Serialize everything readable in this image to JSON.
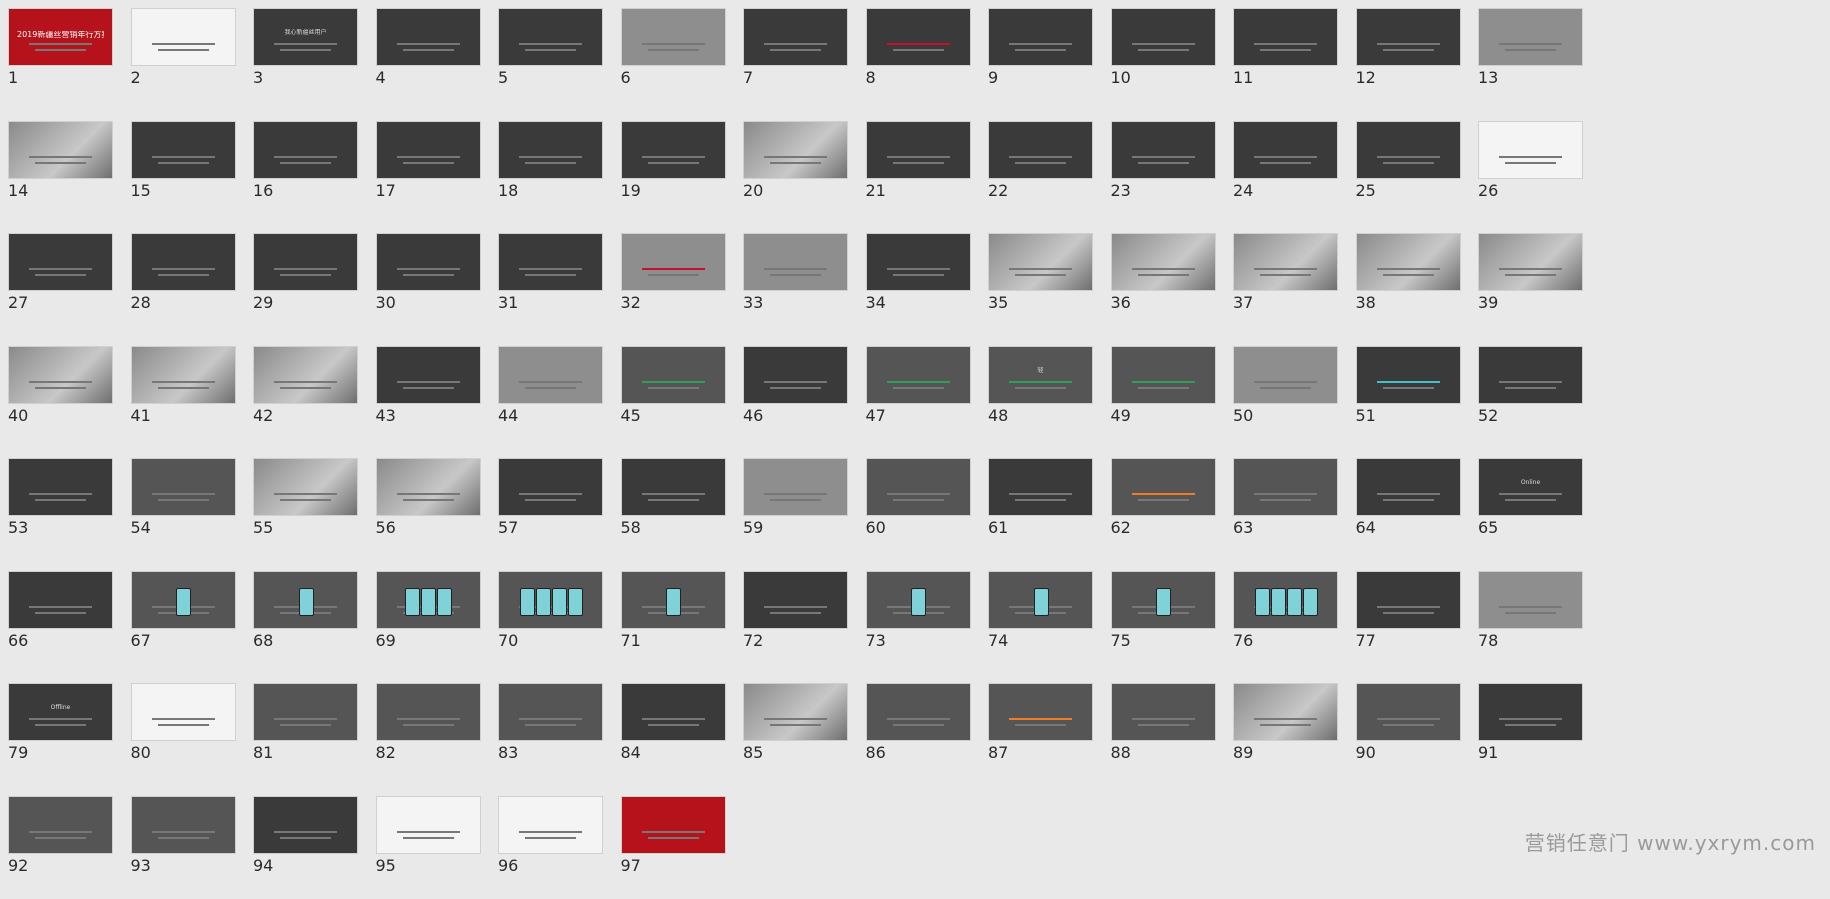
{
  "watermark": "营销任意门 www.yxrym.com",
  "slides": [
    {
      "n": "1",
      "style": "red",
      "caption": "2019新疆丝营销年行方案"
    },
    {
      "n": "2",
      "style": "light",
      "caption": ""
    },
    {
      "n": "3",
      "style": "dark",
      "caption": "我心新疆丝用户"
    },
    {
      "n": "4",
      "style": "dark",
      "caption": ""
    },
    {
      "n": "5",
      "style": "dark",
      "caption": ""
    },
    {
      "n": "6",
      "style": "grey",
      "caption": ""
    },
    {
      "n": "7",
      "style": "dark",
      "caption": ""
    },
    {
      "n": "8",
      "style": "dark",
      "caption": "",
      "accent": "red"
    },
    {
      "n": "9",
      "style": "dark",
      "caption": ""
    },
    {
      "n": "10",
      "style": "dark",
      "caption": ""
    },
    {
      "n": "11",
      "style": "dark",
      "caption": ""
    },
    {
      "n": "12",
      "style": "dark",
      "caption": ""
    },
    {
      "n": "13",
      "style": "grey",
      "caption": ""
    },
    {
      "n": "14",
      "style": "photo",
      "caption": ""
    },
    {
      "n": "15",
      "style": "dark",
      "caption": ""
    },
    {
      "n": "16",
      "style": "dark",
      "caption": ""
    },
    {
      "n": "17",
      "style": "dark",
      "caption": ""
    },
    {
      "n": "18",
      "style": "dark",
      "caption": ""
    },
    {
      "n": "19",
      "style": "dark",
      "caption": ""
    },
    {
      "n": "20",
      "style": "photo",
      "caption": ""
    },
    {
      "n": "21",
      "style": "dark",
      "caption": ""
    },
    {
      "n": "22",
      "style": "dark",
      "caption": ""
    },
    {
      "n": "23",
      "style": "dark",
      "caption": ""
    },
    {
      "n": "24",
      "style": "dark",
      "caption": ""
    },
    {
      "n": "25",
      "style": "dark",
      "caption": ""
    },
    {
      "n": "26",
      "style": "light",
      "caption": ""
    },
    {
      "n": "27",
      "style": "dark",
      "caption": ""
    },
    {
      "n": "28",
      "style": "dark",
      "caption": ""
    },
    {
      "n": "29",
      "style": "dark",
      "caption": ""
    },
    {
      "n": "30",
      "style": "dark",
      "caption": ""
    },
    {
      "n": "31",
      "style": "dark",
      "caption": ""
    },
    {
      "n": "32",
      "style": "grey",
      "caption": "",
      "accent": "red"
    },
    {
      "n": "33",
      "style": "grey",
      "caption": ""
    },
    {
      "n": "34",
      "style": "dark",
      "caption": ""
    },
    {
      "n": "35",
      "style": "photo",
      "caption": ""
    },
    {
      "n": "36",
      "style": "photo",
      "caption": ""
    },
    {
      "n": "37",
      "style": "photo",
      "caption": ""
    },
    {
      "n": "38",
      "style": "photo",
      "caption": ""
    },
    {
      "n": "39",
      "style": "photo",
      "caption": ""
    },
    {
      "n": "40",
      "style": "photo",
      "caption": ""
    },
    {
      "n": "41",
      "style": "photo",
      "caption": ""
    },
    {
      "n": "42",
      "style": "photo",
      "caption": ""
    },
    {
      "n": "43",
      "style": "dark",
      "caption": ""
    },
    {
      "n": "44",
      "style": "grey",
      "caption": ""
    },
    {
      "n": "45",
      "style": "mid",
      "caption": "",
      "accent": "green"
    },
    {
      "n": "46",
      "style": "dark",
      "caption": ""
    },
    {
      "n": "47",
      "style": "mid",
      "caption": "",
      "accent": "green"
    },
    {
      "n": "48",
      "style": "mid",
      "caption": "轻",
      "accent": "green"
    },
    {
      "n": "49",
      "style": "mid",
      "caption": "",
      "accent": "green"
    },
    {
      "n": "50",
      "style": "grey",
      "caption": ""
    },
    {
      "n": "51",
      "style": "dark",
      "caption": "",
      "accent": "teal"
    },
    {
      "n": "52",
      "style": "dark",
      "caption": ""
    },
    {
      "n": "53",
      "style": "dark",
      "caption": ""
    },
    {
      "n": "54",
      "style": "mid",
      "caption": ""
    },
    {
      "n": "55",
      "style": "photo",
      "caption": ""
    },
    {
      "n": "56",
      "style": "photo",
      "caption": ""
    },
    {
      "n": "57",
      "style": "dark",
      "caption": ""
    },
    {
      "n": "58",
      "style": "dark",
      "caption": ""
    },
    {
      "n": "59",
      "style": "grey",
      "caption": ""
    },
    {
      "n": "60",
      "style": "mid",
      "caption": ""
    },
    {
      "n": "61",
      "style": "dark",
      "caption": ""
    },
    {
      "n": "62",
      "style": "mid",
      "caption": "",
      "accent": "orange"
    },
    {
      "n": "63",
      "style": "mid",
      "caption": ""
    },
    {
      "n": "64",
      "style": "dark",
      "caption": ""
    },
    {
      "n": "65",
      "style": "dark",
      "caption": "Online"
    },
    {
      "n": "66",
      "style": "dark",
      "caption": ""
    },
    {
      "n": "67",
      "style": "mid",
      "caption": "",
      "phones": 1
    },
    {
      "n": "68",
      "style": "mid",
      "caption": "",
      "phones": 1
    },
    {
      "n": "69",
      "style": "mid",
      "caption": "",
      "phones": 3
    },
    {
      "n": "70",
      "style": "mid",
      "caption": "",
      "phones": 4
    },
    {
      "n": "71",
      "style": "mid",
      "caption": "",
      "phones": 1
    },
    {
      "n": "72",
      "style": "dark",
      "caption": ""
    },
    {
      "n": "73",
      "style": "mid",
      "caption": "",
      "phones": 1
    },
    {
      "n": "74",
      "style": "mid",
      "caption": "",
      "phones": 1
    },
    {
      "n": "75",
      "style": "mid",
      "caption": "",
      "phones": 1
    },
    {
      "n": "76",
      "style": "mid",
      "caption": "",
      "phones": 4
    },
    {
      "n": "77",
      "style": "dark",
      "caption": ""
    },
    {
      "n": "78",
      "style": "grey",
      "caption": ""
    },
    {
      "n": "79",
      "style": "dark",
      "caption": "Offline"
    },
    {
      "n": "80",
      "style": "light",
      "caption": ""
    },
    {
      "n": "81",
      "style": "mid",
      "caption": ""
    },
    {
      "n": "82",
      "style": "mid",
      "caption": ""
    },
    {
      "n": "83",
      "style": "mid",
      "caption": ""
    },
    {
      "n": "84",
      "style": "dark",
      "caption": ""
    },
    {
      "n": "85",
      "style": "photo",
      "caption": ""
    },
    {
      "n": "86",
      "style": "mid",
      "caption": ""
    },
    {
      "n": "87",
      "style": "mid",
      "caption": "",
      "accent": "orange"
    },
    {
      "n": "88",
      "style": "mid",
      "caption": ""
    },
    {
      "n": "89",
      "style": "photo",
      "caption": ""
    },
    {
      "n": "90",
      "style": "mid",
      "caption": ""
    },
    {
      "n": "91",
      "style": "dark",
      "caption": ""
    },
    {
      "n": "92",
      "style": "mid",
      "caption": ""
    },
    {
      "n": "93",
      "style": "mid",
      "caption": ""
    },
    {
      "n": "94",
      "style": "dark",
      "caption": ""
    },
    {
      "n": "95",
      "style": "light",
      "caption": ""
    },
    {
      "n": "96",
      "style": "light",
      "caption": ""
    },
    {
      "n": "97",
      "style": "red",
      "caption": ""
    }
  ]
}
